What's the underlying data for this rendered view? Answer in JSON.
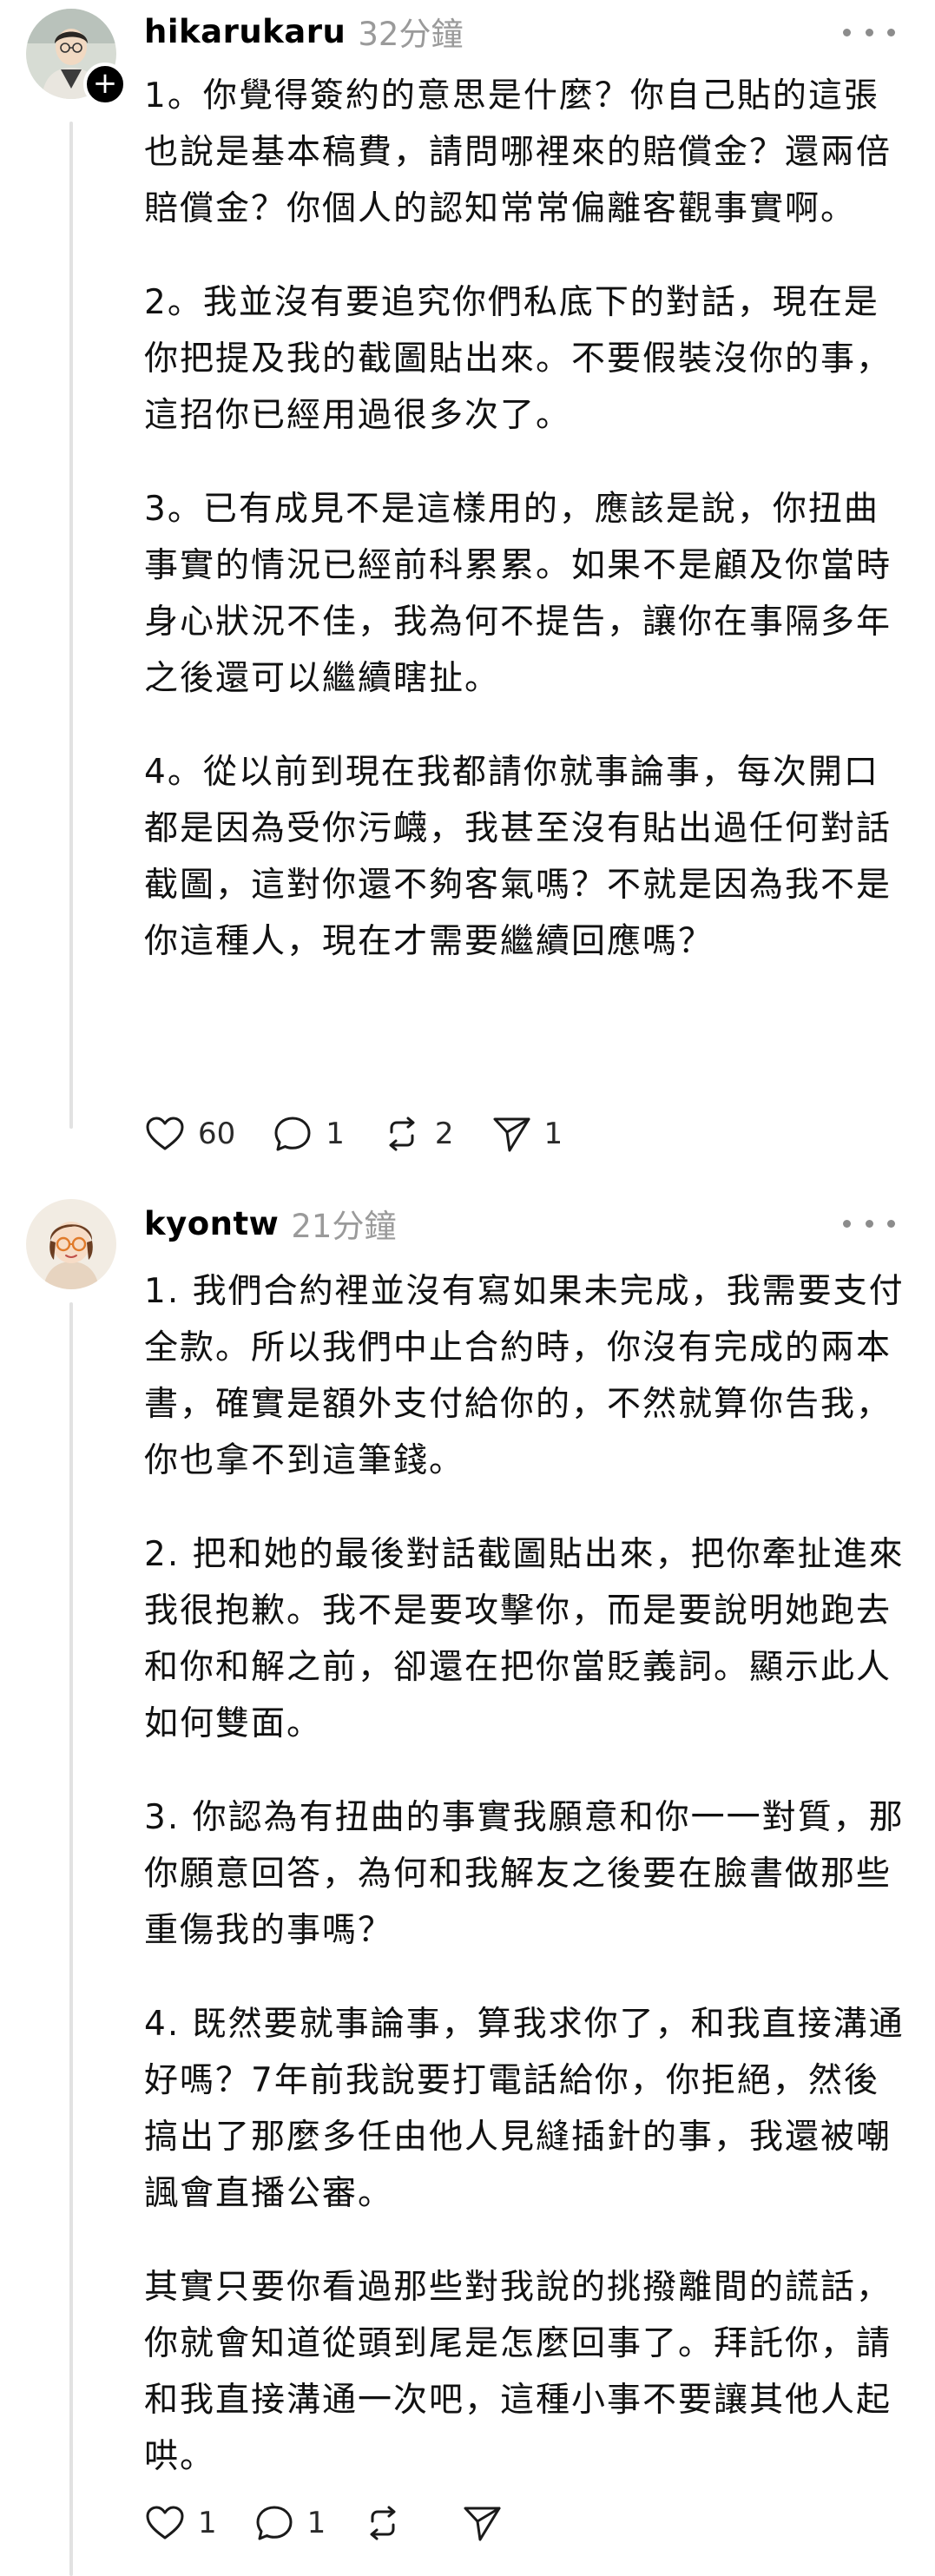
{
  "posts": [
    {
      "username": "hikarukaru",
      "time": "32分鐘",
      "paragraphs": [
        "1。你覺得簽約的意思是什麼？你自己貼的這張也說是基本稿費，請問哪裡來的賠償金？還兩倍賠償金？你個人的認知常常偏離客觀事實啊。",
        "2。我並沒有要追究你們私底下的對話，現在是你把提及我的截圖貼出來。不要假裝沒你的事，這招你已經用過很多次了。",
        "3。已有成見不是這樣用的，應該是說，你扭曲事實的情況已經前科累累。如果不是顧及你當時身心狀況不佳，我為何不提告，讓你在事隔多年之後還可以繼續瞎扯。",
        "4。從以前到現在我都請你就事論事，每次開口都是因為受你污衊，我甚至沒有貼出過任何對話截圖，這對你還不夠客氣嗎？不就是因為我不是你這種人，現在才需要繼續回應嗎？"
      ],
      "actions": {
        "likes": "60",
        "replies": "1",
        "reposts": "2",
        "shares": "1"
      },
      "avatar_icon": "person-with-glasses-avatar",
      "follow_icon": "plus-icon",
      "follow_glyph": "+"
    },
    {
      "username": "kyontw",
      "time": "21分鐘",
      "paragraphs": [
        "1. 我們合約裡並沒有寫如果未完成，我需要支付全款。所以我們中止合約時，你沒有完成的兩本書，確實是額外支付給你的，不然就算你告我，你也拿不到這筆錢。",
        "2. 把和她的最後對話截圖貼出來，把你牽扯進來我很抱歉。我不是要攻擊你，而是要說明她跑去和你和解之前，卻還在把你當貶義詞。顯示此人如何雙面。",
        "3. 你認為有扭曲的事實我願意和你一一對質，那你願意回答，為何和我解友之後要在臉書做那些重傷我的事嗎？",
        "4. 既然要就事論事，算我求你了，和我直接溝通好嗎？7年前我說要打電話給你，你拒絕，然後搞出了那麼多任由他人見縫插針的事，我還被嘲諷會直播公審。",
        "其實只要你看過那些對我說的挑撥離間的謊話，你就會知道從頭到尾是怎麼回事了。拜託你，請和我直接溝通一次吧，這種小事不要讓其他人起哄。"
      ],
      "actions": {
        "likes": "1",
        "replies": "1",
        "reposts": "",
        "shares": ""
      },
      "avatar_icon": "person-with-orange-glasses-avatar"
    }
  ],
  "colors": {
    "text": "#111111",
    "muted": "#9a9a9a",
    "thread_line": "#e2e2e2",
    "icon": "#1a1a1a"
  }
}
